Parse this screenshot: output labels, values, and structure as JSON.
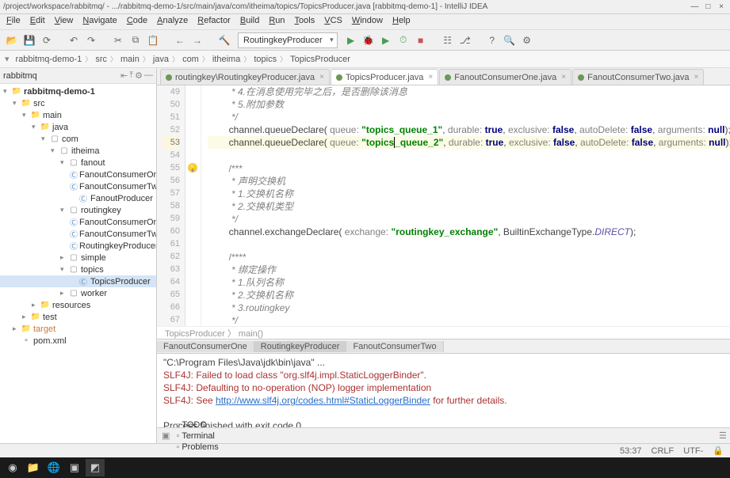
{
  "window": {
    "title": "/project/workspace/rabbitmq/ - .../rabbitmq-demo-1/src/main/java/com/itheima/topics/TopicsProducer.java [rabbitmq-demo-1] - IntelliJ IDEA"
  },
  "menu": [
    "File",
    "Edit",
    "View",
    "Navigate",
    "Code",
    "Analyze",
    "Refactor",
    "Build",
    "Run",
    "Tools",
    "VCS",
    "Window",
    "Help"
  ],
  "run_config": "RoutingkeyProducer",
  "breadcrumb": [
    "rabbitmq-demo-1",
    "src",
    "main",
    "java",
    "com",
    "itheima",
    "topics",
    "TopicsProducer"
  ],
  "project": {
    "header": "rabbitmq",
    "tree": [
      {
        "indent": 0,
        "caret": "▾",
        "icon": "folder",
        "name": "rabbitmq-demo-1",
        "cls": "root"
      },
      {
        "indent": 1,
        "caret": "▾",
        "icon": "folder",
        "name": "src"
      },
      {
        "indent": 2,
        "caret": "▾",
        "icon": "folder",
        "name": "main"
      },
      {
        "indent": 3,
        "caret": "▾",
        "icon": "folder",
        "name": "java"
      },
      {
        "indent": 4,
        "caret": "▾",
        "icon": "pkg",
        "name": "com"
      },
      {
        "indent": 5,
        "caret": "▾",
        "icon": "pkg",
        "name": "itheima"
      },
      {
        "indent": 6,
        "caret": "▾",
        "icon": "pkg",
        "name": "fanout"
      },
      {
        "indent": 7,
        "caret": "",
        "icon": "cls",
        "name": "FanoutConsumerOne"
      },
      {
        "indent": 7,
        "caret": "",
        "icon": "cls",
        "name": "FanoutConsumerTwo"
      },
      {
        "indent": 7,
        "caret": "",
        "icon": "cls",
        "name": "FanoutProducer"
      },
      {
        "indent": 6,
        "caret": "▾",
        "icon": "pkg",
        "name": "routingkey"
      },
      {
        "indent": 7,
        "caret": "",
        "icon": "cls",
        "name": "FanoutConsumerOne"
      },
      {
        "indent": 7,
        "caret": "",
        "icon": "cls",
        "name": "FanoutConsumerTwo"
      },
      {
        "indent": 7,
        "caret": "",
        "icon": "cls",
        "name": "RoutingkeyProducer"
      },
      {
        "indent": 6,
        "caret": "▸",
        "icon": "pkg",
        "name": "simple"
      },
      {
        "indent": 6,
        "caret": "▾",
        "icon": "pkg",
        "name": "topics"
      },
      {
        "indent": 7,
        "caret": "",
        "icon": "cls",
        "name": "TopicsProducer",
        "sel": true
      },
      {
        "indent": 6,
        "caret": "▸",
        "icon": "pkg",
        "name": "worker"
      },
      {
        "indent": 3,
        "caret": "▸",
        "icon": "folder",
        "name": "resources"
      },
      {
        "indent": 2,
        "caret": "▸",
        "icon": "folder",
        "name": "test"
      },
      {
        "indent": 1,
        "caret": "▸",
        "icon": "folder",
        "name": "target",
        "style": "color:#c97a3a"
      },
      {
        "indent": 1,
        "caret": "",
        "icon": "file",
        "name": "pom.xml"
      }
    ]
  },
  "editor": {
    "tabs": [
      {
        "label": "RoutingkeyProducer.java",
        "path": "routingkey",
        "active": false
      },
      {
        "label": "TopicsProducer.java",
        "active": true
      },
      {
        "label": "FanoutConsumerOne.java",
        "active": false
      },
      {
        "label": "FanoutConsumerTwo.java",
        "active": false
      }
    ],
    "lines_start": 49,
    "lines": [
      {
        "n": 49,
        "html": "         <span class='cmt'>* 4.在消息使用完毕之后，是否删除该消息</span>"
      },
      {
        "n": 50,
        "html": "         <span class='cmt'>* 5.附加参数</span>"
      },
      {
        "n": 51,
        "html": "         <span class='cmt'>*/</span>"
      },
      {
        "n": 52,
        "html": "        channel.queueDeclare( <span class='param'>queue:</span> <span class='str'>\"topics_queue_1\"</span>, <span class='param'>durable:</span> <span class='bool'>true</span>, <span class='param'>exclusive:</span> <span class='bool'>false</span>, <span class='param'>autoDelete:</span> <span class='bool'>false</span>, <span class='param'>arguments:</span> <span class='bool'>null</span>);"
      },
      {
        "n": 53,
        "hl": true,
        "html": "        channel.queueDeclare( <span class='param'>queue:</span> <span class='str'>\"topics<span class='cursor'></span>_queue_2\"</span>, <span class='param'>durable:</span> <span class='bool'>true</span>, <span class='param'>exclusive:</span> <span class='bool'>false</span>, <span class='param'>autoDelete:</span> <span class='bool'>false</span>, <span class='param'>arguments:</span> <span class='bool'>null</span>);"
      },
      {
        "n": 54,
        "html": ""
      },
      {
        "n": 55,
        "html": "        <span class='cmt2'>/***</span>"
      },
      {
        "n": 56,
        "html": "         <span class='cmt'>* 声明交换机</span>"
      },
      {
        "n": 57,
        "html": "         <span class='cmt'>* 1.交换机名称</span>"
      },
      {
        "n": 58,
        "html": "         <span class='cmt'>* 2.交换机类型</span>"
      },
      {
        "n": 59,
        "html": "         <span class='cmt'>*/</span>"
      },
      {
        "n": 60,
        "html": "        channel.exchangeDeclare( <span class='param'>exchange:</span> <span class='str'>\"routingkey_exchange\"</span>, BuiltinExchangeType.<span class='type'>DIRECT</span>);"
      },
      {
        "n": 61,
        "html": ""
      },
      {
        "n": 62,
        "html": "        <span class='cmt2'>/****</span>"
      },
      {
        "n": 63,
        "html": "         <span class='cmt'>* 绑定操作</span>"
      },
      {
        "n": 64,
        "html": "         <span class='cmt'>* 1.队列名称</span>"
      },
      {
        "n": 65,
        "html": "         <span class='cmt'>* 2.交换机名称</span>"
      },
      {
        "n": 66,
        "html": "         <span class='cmt'>* 3.routingkey</span>"
      },
      {
        "n": 67,
        "html": "         <span class='cmt'>*/</span>"
      }
    ],
    "status_crumb": "TopicsProducer 〉 main()"
  },
  "run_tabs": [
    "FanoutConsumerOne",
    "RoutingkeyProducer",
    "FanoutConsumerTwo"
  ],
  "run_tabs_active": 1,
  "console": {
    "lines": [
      {
        "text": "\"C:\\Program Files\\Java\\jdk\\bin\\java\" ..."
      },
      {
        "text": "SLF4J: Failed to load class \"org.slf4j.impl.StaticLoggerBinder\".",
        "cls": "err"
      },
      {
        "text": "SLF4J: Defaulting to no-operation (NOP) logger implementation",
        "cls": "err"
      },
      {
        "pre": "SLF4J: See ",
        "link": "http://www.slf4j.org/codes.html#StaticLoggerBinder",
        "post": " for further details.",
        "cls": "err"
      },
      {
        "text": ""
      },
      {
        "text": "Process finished with exit code 0"
      }
    ]
  },
  "bottom_tools": [
    "TODO",
    "Terminal",
    "Problems"
  ],
  "status": {
    "pos": "53:37",
    "eol": "CRLF",
    "enc": "UTF-"
  }
}
